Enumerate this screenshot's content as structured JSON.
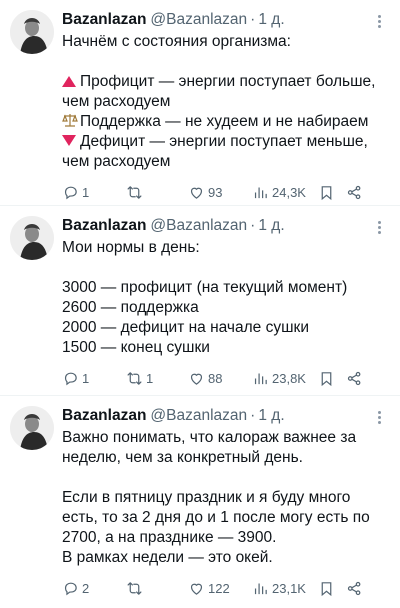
{
  "tweets": [
    {
      "author_name": "Bazanlazan",
      "handle": "@Bazanlazan",
      "separator": "·",
      "time": "1 д.",
      "intro": "Начнём с состояния организма:",
      "items": [
        {
          "icon": "red-triangle-up-icon",
          "text": "Профицит — энергии поступает больше, чем расходуем"
        },
        {
          "icon": "balance-scale-icon",
          "text": "Поддержка — не худеем и не набираем"
        },
        {
          "icon": "red-triangle-down-icon",
          "text": "Дефицит — энергии поступает меньше, чем расходуем"
        }
      ],
      "stats": {
        "replies": "1",
        "retweets": "",
        "likes": "93",
        "views": "24,3K"
      }
    },
    {
      "author_name": "Bazanlazan",
      "handle": "@Bazanlazan",
      "separator": "·",
      "time": "1 д.",
      "intro": "Мои нормы в день:",
      "lines": [
        "3000 — профицит (на текущий момент)",
        "2600 — поддержка",
        "2000 — дефицит на начале сушки",
        "1500 — конец сушки"
      ],
      "stats": {
        "replies": "1",
        "retweets": "1",
        "likes": "88",
        "views": "23,8K"
      }
    },
    {
      "author_name": "Bazanlazan",
      "handle": "@Bazanlazan",
      "separator": "·",
      "time": "1 д.",
      "para1": "Важно понимать, что калораж важнее за неделю, чем за конкретный день.",
      "para2": "Если в пятницу праздник и я буду много есть, то за 2 дня до и 1 после могу есть по 2700, а на празднике — 3900.\nВ рамках недели — это окей.",
      "stats": {
        "replies": "2",
        "retweets": "",
        "likes": "122",
        "views": "23,1K"
      }
    }
  ],
  "colors": {
    "text": "#0f1419",
    "muted": "#536471",
    "accent_red": "#e0245e",
    "divider": "#eff3f4"
  }
}
